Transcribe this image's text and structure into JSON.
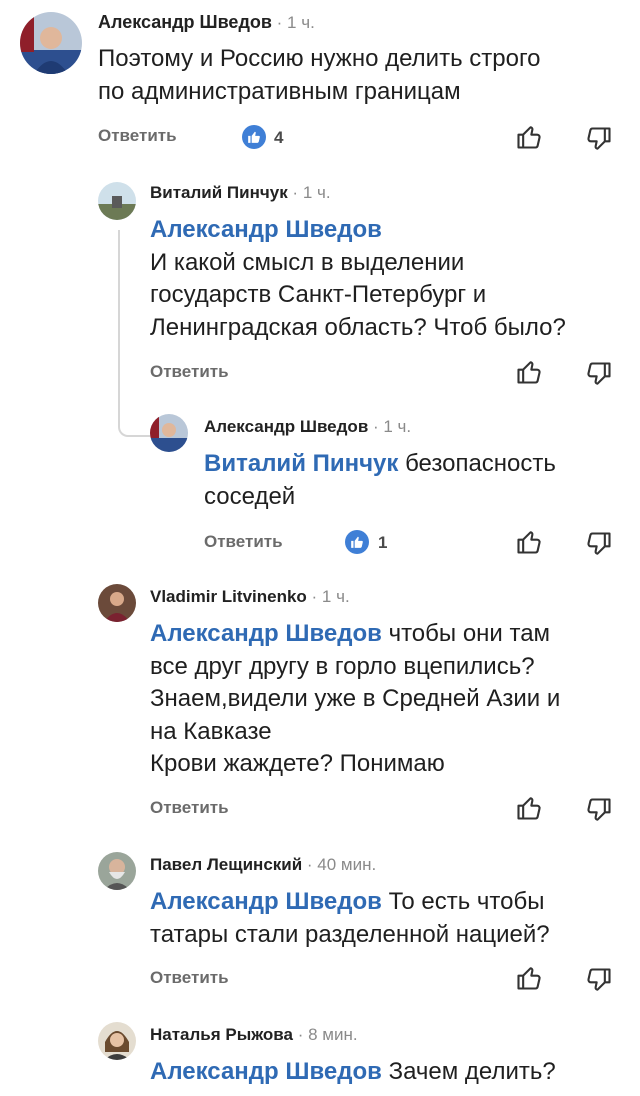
{
  "comments": [
    {
      "author": "Александр Шведов",
      "time": "1 ч.",
      "lines": [
        "Поэтому и Россию нужно делить строго",
        "по административным границам"
      ],
      "reply": "Ответить",
      "likes": "4"
    },
    {
      "author": "Виталий Пинчук",
      "time": "1 ч.",
      "mention": "Александр Шведов",
      "lines": [
        "И какой смысл в выделении",
        "государств Санкт-Петербург и",
        "Ленинградская область? Чтоб было?"
      ],
      "reply": "Ответить"
    },
    {
      "author": "Александр Шведов",
      "time": "1 ч.",
      "mention": "Виталий Пинчук",
      "first_line_rest": " безопасность",
      "lines": [
        "соседей"
      ],
      "reply": "Ответить",
      "likes": "1"
    },
    {
      "author": "Vladimir Litvinenko",
      "time": "1 ч.",
      "mention": "Александр Шведов",
      "first_line_rest": " чтобы они там",
      "lines": [
        "все друг другу в горло вцепились?",
        "Знаем,видели уже в Средней Азии и",
        "на Кавказе",
        "Крови жаждете? Понимаю"
      ],
      "reply": "Ответить"
    },
    {
      "author": "Павел Лещинский",
      "time": "40 мин.",
      "mention": "Александр Шведов",
      "first_line_rest": " То есть чтобы",
      "lines": [
        "татары стали разделенной нацией?"
      ],
      "reply": "Ответить"
    },
    {
      "author": "Наталья Рыжова",
      "time": "8 мин.",
      "mention": "Александр Шведов",
      "first_line_rest": " Зачем делить?"
    }
  ],
  "separator": " · ",
  "icons": {
    "like": "thumb-up-icon",
    "dislike": "thumb-down-icon",
    "likes_badge": "thumb-up-filled-icon"
  },
  "colors": {
    "mention": "#2f6ab4",
    "badge": "#3f7fd6",
    "muted": "#8a8a8a"
  }
}
